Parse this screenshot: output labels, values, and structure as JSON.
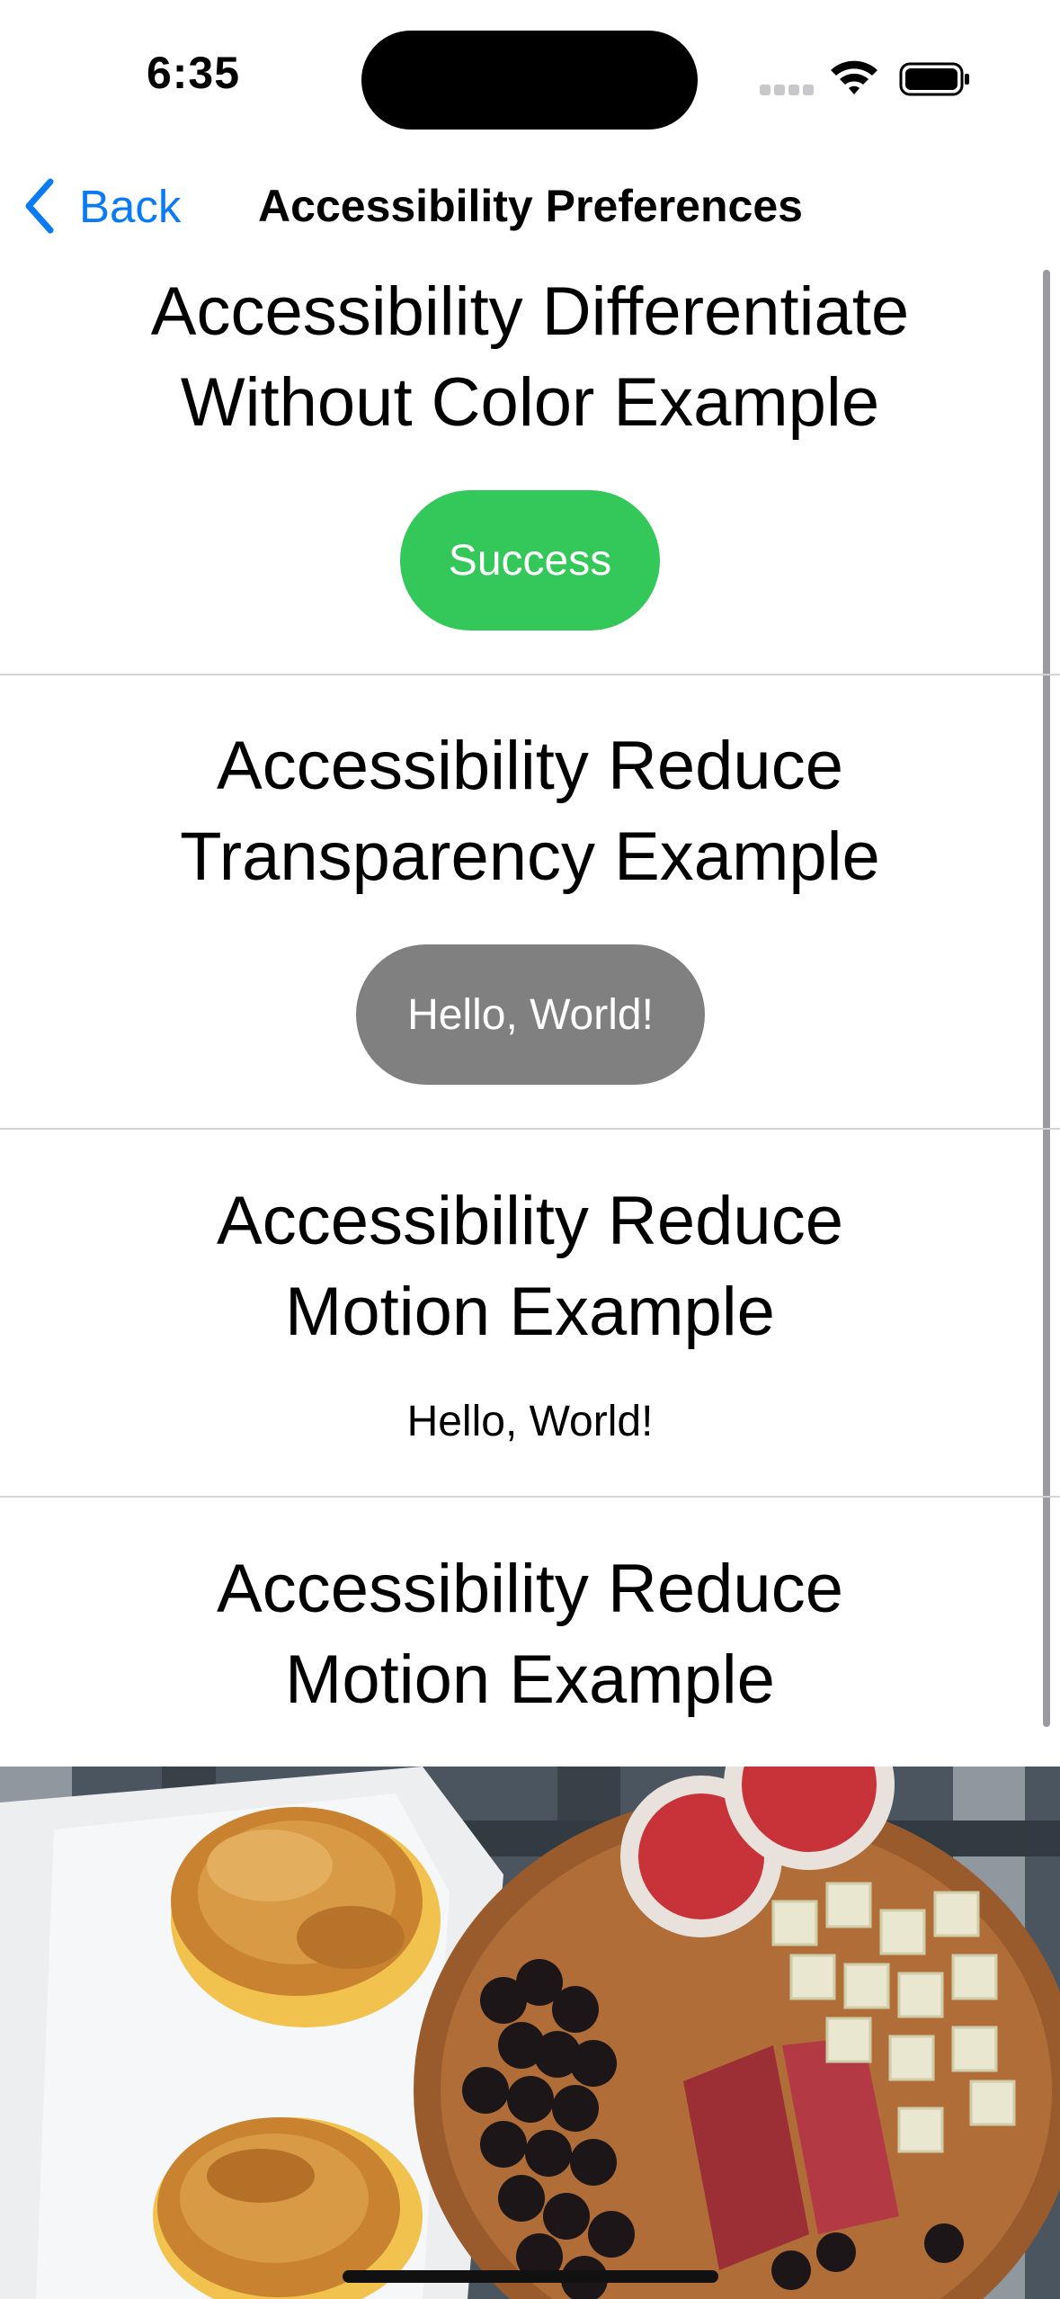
{
  "status_bar": {
    "time": "6:35",
    "icons": [
      "cellular-signal-icon",
      "wifi-icon",
      "battery-icon"
    ]
  },
  "nav": {
    "back_label": "Back",
    "title": "Accessibility Preferences"
  },
  "sections": [
    {
      "title_line1": "Accessibility Differentiate",
      "title_line2": "Without Color Example",
      "content": "Success",
      "content_color": "#34c759"
    },
    {
      "title_line1": "Accessibility Reduce",
      "title_line2": "Transparency Example",
      "content": "Hello, World!",
      "content_color": "#808080"
    },
    {
      "title_line1": "Accessibility Reduce",
      "title_line2": "Motion Example",
      "content": "Hello, World!"
    },
    {
      "title_line1": "Accessibility Reduce",
      "title_line2": "Motion Example"
    }
  ],
  "colors": {
    "accent": "#0a7bf5",
    "success": "#34c759",
    "gray_pill": "#808080",
    "divider": "#d4d4d8"
  }
}
